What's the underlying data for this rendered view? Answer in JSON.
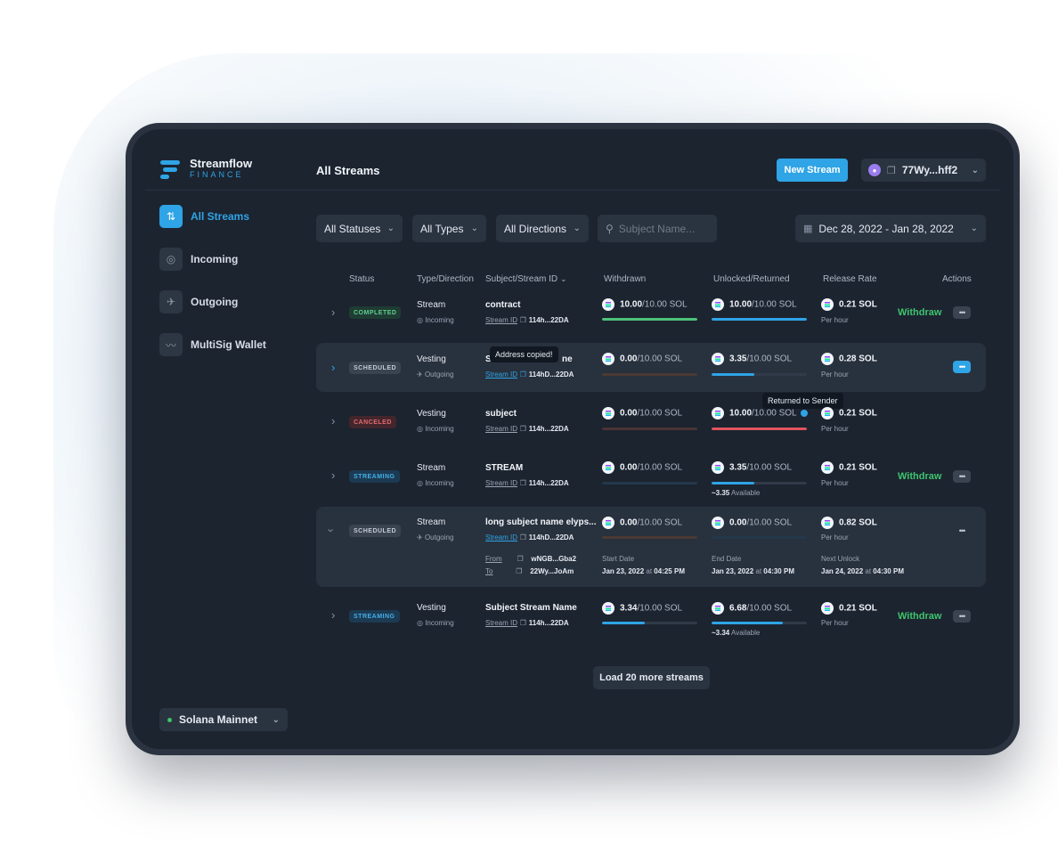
{
  "app": {
    "name": "Streamflow",
    "subtitle": "FINANCE"
  },
  "sidebar": {
    "items": [
      {
        "label": "All Streams",
        "icon": "arrows-updown-icon"
      },
      {
        "label": "Incoming",
        "icon": "target-icon"
      },
      {
        "label": "Outgoing",
        "icon": "rocket-icon"
      },
      {
        "label": "MultiSig Wallet",
        "icon": "signature-icon"
      }
    ],
    "network": "Solana Mainnet"
  },
  "header": {
    "title": "All Streams",
    "new_stream": "New Stream",
    "wallet": "77Wy...hff2"
  },
  "filters": {
    "status": "All Statuses",
    "type": "All Types",
    "direction": "All Directions",
    "search_placeholder": "Subject Name...",
    "date_range": "Dec 28, 2022 - Jan 28, 2022"
  },
  "table": {
    "columns": [
      "Status",
      "Type/Direction",
      "Subject/Stream ID",
      "Withdrawn",
      "Unlocked/Returned",
      "Release Rate",
      "Actions"
    ],
    "stream_id_label": "Stream ID",
    "per_hour": "Per hour",
    "withdraw_label": "Withdraw",
    "rows": [
      {
        "status": "COMPLETED",
        "type": "Stream",
        "direction": "Incoming",
        "subject": "contract",
        "stream_id": "114h...22DA",
        "withdrawn": "10.00",
        "withdrawn_total": "/10.00 SOL",
        "withdrawn_progress": 1.0,
        "unlocked": "10.00",
        "unlocked_total": "/10.00 SOL",
        "unlocked_progress": 1.0,
        "rate": "0.21 SOL",
        "action": "Withdraw"
      },
      {
        "status": "SCHEDULED",
        "type": "Vesting",
        "direction": "Outgoing",
        "subject_visible_start": "S",
        "subject_visible_end": "ne",
        "stream_id": "114hD...22DA",
        "withdrawn": "0.00",
        "withdrawn_total": "/10.00 SOL",
        "withdrawn_progress": 0.0,
        "unlocked": "3.35",
        "unlocked_total": "/10.00 SOL",
        "unlocked_progress": 0.45,
        "rate": "0.28 SOL"
      },
      {
        "status": "CANCELED",
        "type": "Vesting",
        "direction": "Incoming",
        "subject": "subject",
        "stream_id": "114h...22DA",
        "withdrawn": "0.00",
        "withdrawn_total": "/10.00 SOL",
        "withdrawn_progress": 0.0,
        "unlocked": "10.00",
        "unlocked_total": "/10.00 SOL",
        "unlocked_progress": 1.0,
        "rate": "0.21 SOL"
      },
      {
        "status": "STREAMING",
        "type": "Stream",
        "direction": "Incoming",
        "subject": "STREAM",
        "stream_id": "114h...22DA",
        "withdrawn": "0.00",
        "withdrawn_total": "/10.00 SOL",
        "withdrawn_progress": 0.0,
        "unlocked": "3.35",
        "unlocked_total": "/10.00 SOL",
        "unlocked_progress": 0.45,
        "available": "~3.35",
        "rate": "0.21 SOL",
        "action": "Withdraw"
      },
      {
        "status": "SCHEDULED",
        "type": "Stream",
        "direction": "Outgoing",
        "subject": "long subject name elyps...",
        "stream_id": "114hD...22DA",
        "withdrawn": "0.00",
        "withdrawn_total": "/10.00 SOL",
        "withdrawn_progress": 0.0,
        "unlocked": "0.00",
        "unlocked_total": "/10.00 SOL",
        "unlocked_progress": 0.0,
        "rate": "0.82 SOL",
        "details": {
          "from_label": "From",
          "from": "wNGB...Gba2",
          "to_label": "To",
          "to": "22Wy...JoAm",
          "start_label": "Start Date",
          "start_date": "Jan 23, 2022",
          "start_time": "04:25 PM",
          "end_label": "End Date",
          "end_date": "Jan 23, 2022",
          "end_time": "04:30 PM",
          "next_label": "Next Unlock",
          "next_date": "Jan 24, 2022",
          "next_time": "04:30 PM",
          "at": "at"
        }
      },
      {
        "status": "STREAMING",
        "type": "Vesting",
        "direction": "Incoming",
        "subject": "Subject Stream Name",
        "stream_id": "114h...22DA",
        "withdrawn": "3.34",
        "withdrawn_total": "/10.00 SOL",
        "withdrawn_progress": 0.45,
        "unlocked": "6.68",
        "unlocked_total": "/10.00 SOL",
        "unlocked_progress": 0.75,
        "available": "~3.34",
        "rate": "0.21 SOL",
        "action": "Withdraw"
      }
    ],
    "available_label": "Available"
  },
  "tooltips": {
    "copied": "Address copied!",
    "returned": "Returned to Sender"
  },
  "load_more": "Load 20 more streams",
  "colors": {
    "accent": "#2fa4e6",
    "success": "#3ec46d",
    "danger": "#e46a6f",
    "background": "#1c2430"
  }
}
